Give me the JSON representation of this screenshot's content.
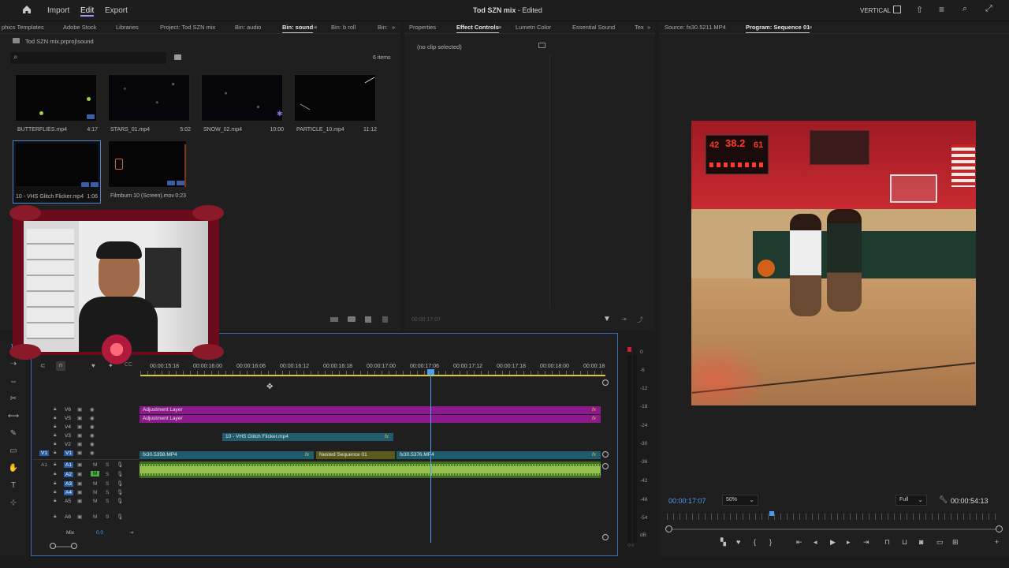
{
  "topbar": {
    "menus": [
      "Import",
      "Edit",
      "Export"
    ],
    "active_menu": "Edit",
    "title": "Tod SZN mix",
    "status": "Edited",
    "workspace": "VERTICAL"
  },
  "project_panel": {
    "tabs": [
      "phics Templates",
      "Adobe Stock",
      "Libraries",
      "Project: Tod SZN mix",
      "Bin: audio",
      "Bin: sound",
      "Bin: b roll",
      "Bin:"
    ],
    "active_tab": "Bin: sound",
    "path": "Tod SZN mix.prproj\\sound",
    "search_placeholder": "",
    "item_count": "6 items",
    "items": [
      {
        "name": "BUTTERFLIES.mp4",
        "duration": "4:17"
      },
      {
        "name": "STARS_01.mp4",
        "duration": "5:02"
      },
      {
        "name": "SNOW_02.mp4",
        "duration": "10:00"
      },
      {
        "name": "PARTICLE_10.mp4",
        "duration": "11:12"
      },
      {
        "name": "10 - VHS Glitch Flicker.mp4",
        "duration": "1:06"
      },
      {
        "name": "Filmburn 10 (Screen).mov",
        "duration": "0:23"
      }
    ]
  },
  "effects_panel": {
    "tabs": [
      "Properties",
      "Effect Controls",
      "Lumetri Color",
      "Essential Sound",
      "Tex"
    ],
    "active_tab": "Effect Controls",
    "no_clip": "(no clip selected)",
    "timecode": "00:00:17:07"
  },
  "program_panel": {
    "tabs": [
      "Source: fx30.5211.MP4",
      "Program: Sequence 01"
    ],
    "active_tab": "Program: Sequence 01",
    "timecode": "00:00:17:07",
    "zoom": "50%",
    "quality": "Full",
    "duration": "00:00:54:13",
    "scoreboard": {
      "home": "42",
      "clock": "38.2",
      "away": "61"
    }
  },
  "timeline": {
    "ruler": [
      "00:00:15:18",
      "00:00:16:00",
      "00:00:16:06",
      "00:00:16:12",
      "00:00:16:18",
      "00:00:17:00",
      "00:00:17:06",
      "00:00:17:12",
      "00:00:17:18",
      "00:00:18:00",
      "00:00:18"
    ],
    "video_tracks": [
      "V6",
      "V5",
      "V4",
      "V3",
      "V2",
      "V1"
    ],
    "audio_tracks": [
      "A1",
      "A2",
      "A3",
      "A4",
      "A5",
      "A6"
    ],
    "source_v": "V1",
    "source_a": "A1",
    "mix_label": "Mix",
    "mix_value": "0.0",
    "clips": {
      "adj1": "Adjustment Layer",
      "adj2": "Adjustment Layer",
      "vhs": "10 - VHS Glitch Flicker.mp4",
      "v1a": "fx30.5358.MP4",
      "nested": "Nested Sequence 01",
      "v1b": "fx30.5376.MP4",
      "fx": "fx"
    }
  },
  "meters": {
    "scale": [
      "0",
      "-6",
      "-12",
      "-18",
      "-24",
      "-30",
      "-36",
      "-42",
      "-48",
      "-54",
      "dB"
    ]
  },
  "colors": {
    "accent": "#2d8ceb",
    "adjustment": "#8c1a8c",
    "video_clip": "#1f5d6e",
    "nested": "#5a5a1e",
    "audio": "#8fc04a"
  }
}
